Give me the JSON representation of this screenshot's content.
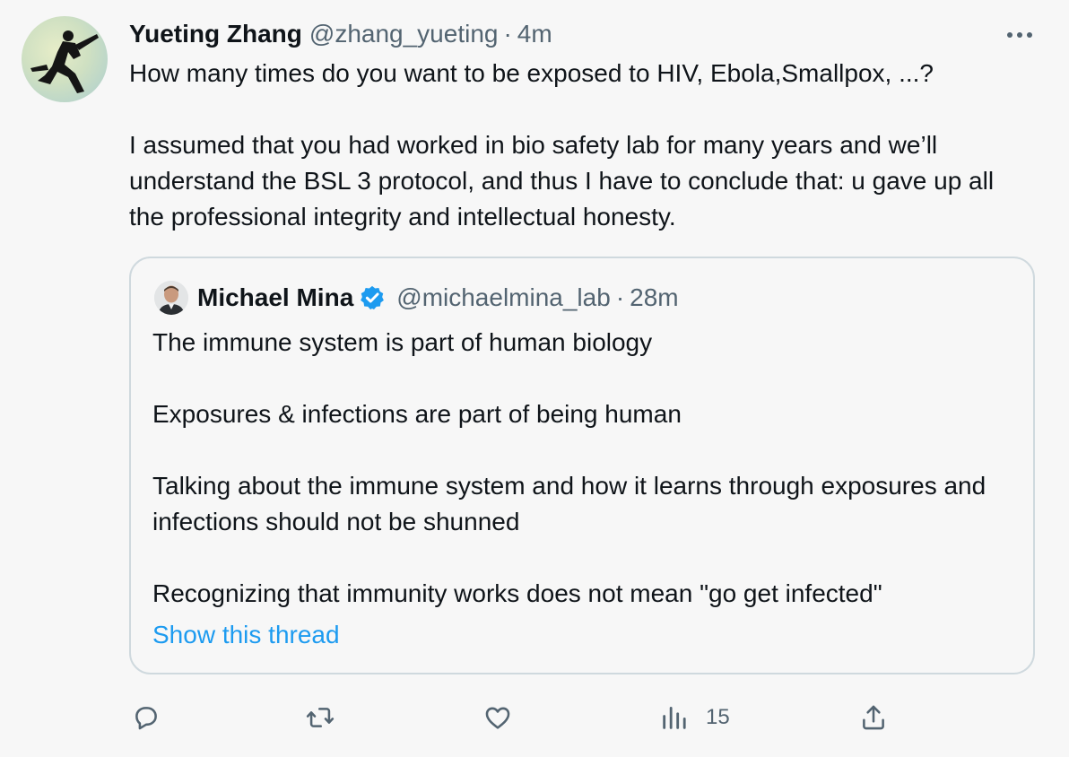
{
  "author": {
    "name": "Yueting Zhang",
    "handle": "@zhang_yueting",
    "separator": "·",
    "time": "4m"
  },
  "more_icon": "more-horizontal-icon",
  "tweet_text": {
    "p1": "How many times do you want to be exposed to HIV, Ebola,Smallpox, ...?",
    "p2": "I assumed that you had worked in bio safety lab for many years and we’ll understand the BSL 3 protocol, and thus I have to conclude that: u gave up all the professional integrity and intellectual honesty."
  },
  "quoted": {
    "name": "Michael Mina",
    "verified_icon": "verified-badge-icon",
    "handle": "@michaelmina_lab",
    "separator": "·",
    "time": "28m",
    "paragraphs": [
      "The immune system is part of human biology",
      "Exposures & infections are part of being human",
      "Talking about the immune system and how it learns through exposures and infections should not be shunned",
      "Recognizing that immunity works does not mean \"go get infected\""
    ],
    "show_thread": "Show this thread"
  },
  "actions": {
    "reply_icon": "reply-icon",
    "retweet_icon": "retweet-icon",
    "like_icon": "like-icon",
    "views_icon": "views-icon",
    "views_count": "15",
    "share_icon": "share-icon"
  },
  "colors": {
    "background": "#f7f7f7",
    "text": "#0f1419",
    "secondary": "#536471",
    "link": "#1d9bf0",
    "border": "#cfd9de"
  }
}
